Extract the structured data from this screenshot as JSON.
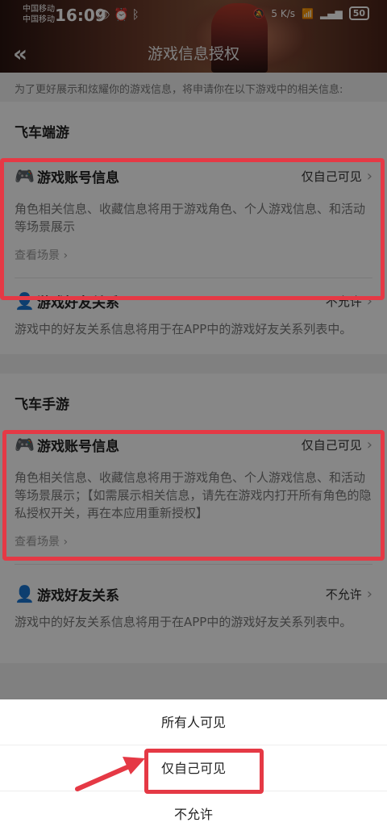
{
  "statusbar": {
    "carrier1": "中国移动",
    "carrier2": "中国移动",
    "time": "16:09",
    "net_speed": "5 K/s",
    "battery": "50"
  },
  "header": {
    "title": "游戏信息授权"
  },
  "intro": "为了更好展示和炫耀你的游戏信息，将申请你在以下游戏中的相关信息:",
  "sections": [
    {
      "title": "飞车端游",
      "items": [
        {
          "name": "游戏账号信息",
          "status": "仅自己可见",
          "desc": "角色相关信息、收藏信息将用于游戏角色、个人游戏信息、和活动等场景展示",
          "scene": "查看场景"
        },
        {
          "name": "游戏好友关系",
          "status": "不允许",
          "desc": "游戏中的好友关系信息将用于在APP中的游戏好友关系列表中。"
        }
      ]
    },
    {
      "title": "飞车手游",
      "items": [
        {
          "name": "游戏账号信息",
          "status": "仅自己可见",
          "desc": "角色相关信息、收藏信息将用于游戏角色、个人游戏信息、和活动等场景展示；【如需展示相关信息，请先在游戏内打开所有角色的隐私授权开关，再在本应用重新授权】",
          "scene": "查看场景"
        },
        {
          "name": "游戏好友关系",
          "status": "不允许",
          "desc": "游戏中的好友关系信息将用于在APP中的游戏好友关系列表中。"
        }
      ]
    }
  ],
  "sheet": {
    "options": [
      "所有人可见",
      "仅自己可见",
      "不允许"
    ]
  },
  "colors": {
    "annotation": "#e53945",
    "overlay": "rgba(0,0,0,0.47)"
  }
}
